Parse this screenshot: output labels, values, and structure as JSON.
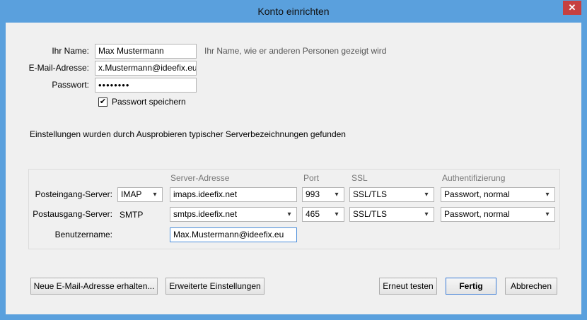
{
  "window": {
    "title": "Konto einrichten",
    "close_glyph": "✕"
  },
  "form": {
    "name": {
      "label": "Ihr Name:",
      "value": "Max Mustermann",
      "hint": "Ihr Name, wie er anderen Personen gezeigt wird"
    },
    "email": {
      "label": "E-Mail-Adresse:",
      "value": "x.Mustermann@ideefix.eu"
    },
    "password": {
      "label": "Passwort:",
      "value": "••••••••"
    },
    "remember": {
      "label": "Passwort speichern",
      "checked": true,
      "glyph": "✔"
    }
  },
  "status_message": "Einstellungen wurden durch Ausprobieren typischer Serverbezeichnungen gefunden",
  "server_table": {
    "headers": {
      "server": "Server-Adresse",
      "port": "Port",
      "ssl": "SSL",
      "auth": "Authentifizierung"
    },
    "incoming": {
      "label": "Posteingang-Server:",
      "protocol": "IMAP",
      "server": "imaps.ideefix.net",
      "port": "993",
      "ssl": "SSL/TLS",
      "auth": "Passwort, normal"
    },
    "outgoing": {
      "label": "Postausgang-Server:",
      "protocol": "SMTP",
      "server": "smtps.ideefix.net",
      "port": "465",
      "ssl": "SSL/TLS",
      "auth": "Passwort, normal"
    },
    "username": {
      "label": "Benutzername:",
      "value": "Max.Mustermann@ideefix.eu"
    }
  },
  "buttons": {
    "new_address": "Neue E-Mail-Adresse erhalten...",
    "advanced": "Erweiterte Einstellungen",
    "retest": "Erneut testen",
    "done": "Fertig",
    "cancel": "Abbrechen"
  },
  "icons": {
    "dropdown": "▾"
  },
  "colors": {
    "titlebar": "#5aa0dd",
    "close": "#c64040",
    "dialog_bg": "#f0f0f0",
    "focus_border": "#4c8edb"
  }
}
